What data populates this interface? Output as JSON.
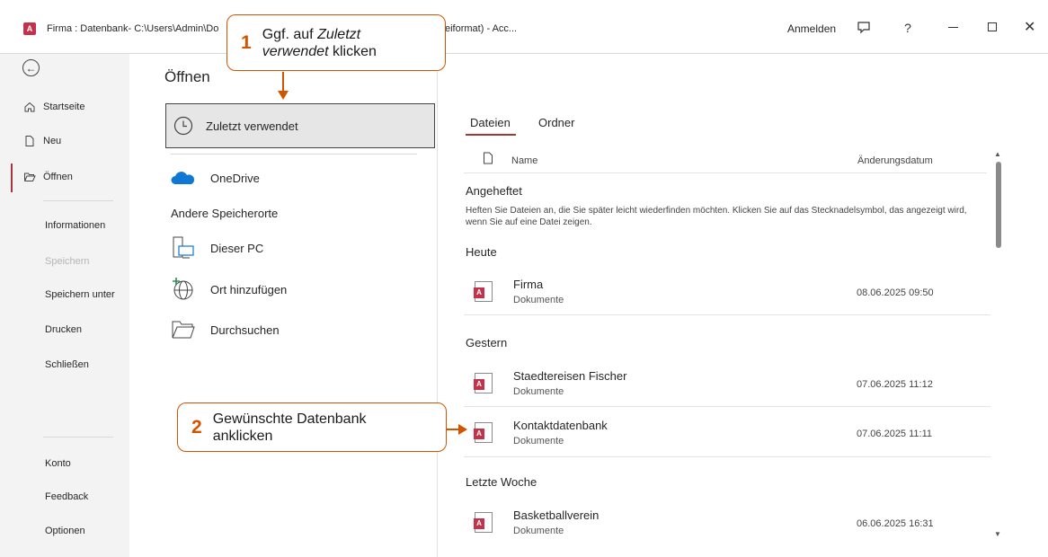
{
  "titlebar": {
    "title_left": "Firma : Datenbank- C:\\Users\\Admin\\Do",
    "title_right": "eiformat) - Acc...",
    "sign_in": "Anmelden",
    "help": "?"
  },
  "sidebar": {
    "items": [
      {
        "label": "Startseite"
      },
      {
        "label": "Neu"
      },
      {
        "label": "Öffnen"
      },
      {
        "label": "Informationen"
      },
      {
        "label": "Speichern"
      },
      {
        "label": "Speichern unter"
      },
      {
        "label": "Drucken"
      },
      {
        "label": "Schließen"
      },
      {
        "label": "Konto"
      },
      {
        "label": "Feedback"
      },
      {
        "label": "Optionen"
      }
    ],
    "active": "Öffnen"
  },
  "open_panel": {
    "heading": "Öffnen",
    "recent": "Zuletzt verwendet",
    "onedrive": "OneDrive",
    "other_locations": "Andere Speicherorte",
    "this_pc": "Dieser PC",
    "add_place": "Ort hinzufügen",
    "browse": "Durchsuchen"
  },
  "file_list": {
    "tabs": [
      "Dateien",
      "Ordner"
    ],
    "active_tab": "Dateien",
    "col_name": "Name",
    "col_date": "Änderungsdatum",
    "pinned_label": "Angeheftet",
    "pinned_note": "Heften Sie Dateien an, die Sie später leicht wiederfinden möchten. Klicken Sie auf das Stecknadelsymbol, das angezeigt wird, wenn Sie auf eine Datei zeigen.",
    "groups": [
      {
        "label": "Heute",
        "files": [
          {
            "name": "Firma",
            "location": "Dokumente",
            "date": "08.06.2025 09:50"
          }
        ]
      },
      {
        "label": "Gestern",
        "files": [
          {
            "name": "Staedtereisen Fischer",
            "location": "Dokumente",
            "date": "07.06.2025 11:12"
          },
          {
            "name": "Kontaktdatenbank",
            "location": "Dokumente",
            "date": "07.06.2025 11:11"
          }
        ]
      },
      {
        "label": "Letzte Woche",
        "files": [
          {
            "name": "Basketballverein",
            "location": "Dokumente",
            "date": "06.06.2025 16:31"
          }
        ]
      }
    ]
  },
  "callouts": {
    "c1": {
      "num": "1",
      "line1_pre": "Ggf. auf ",
      "line1_em": "Zuletzt",
      "line2_em": "verwendet",
      "line2_post": " klicken"
    },
    "c2": {
      "num": "2",
      "line1": "Gewünschte Datenbank",
      "line2": "anklicken"
    }
  },
  "colors": {
    "accent": "#a4373a",
    "callout": "#d35400",
    "access_red": "#c4314b"
  }
}
